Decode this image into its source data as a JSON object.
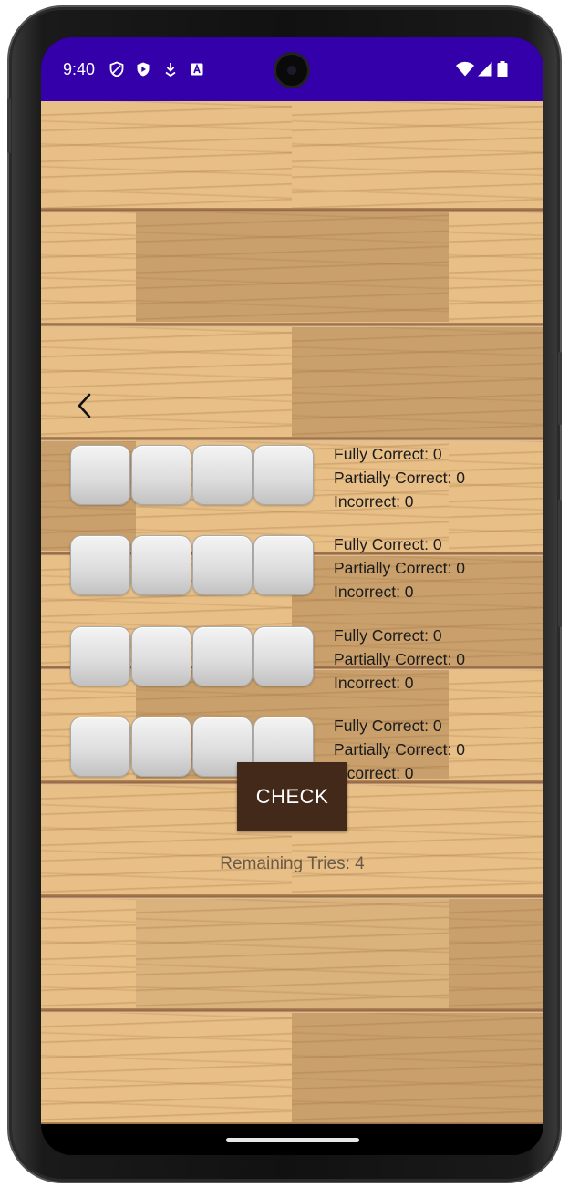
{
  "status_bar": {
    "time": "9:40",
    "left_icons": [
      "shield-outline-icon",
      "shield-play-icon",
      "download-arrow-icon",
      "a-box-icon"
    ],
    "right_icons": [
      "wifi-icon",
      "signal-icon",
      "battery-icon"
    ],
    "background_color": "#3300aa"
  },
  "board": {
    "rows": [
      {
        "fully_correct": "Fully Correct: 0",
        "partially_correct": "Partially Correct: 0",
        "incorrect": "Incorrect: 0"
      },
      {
        "fully_correct": "Fully Correct: 0",
        "partially_correct": "Partially Correct: 0",
        "incorrect": "Incorrect: 0"
      },
      {
        "fully_correct": "Fully Correct: 0",
        "partially_correct": "Partially Correct: 0",
        "incorrect": "Incorrect: 0"
      },
      {
        "fully_correct": "Fully Correct: 0",
        "partially_correct": "Partially Correct: 0",
        "incorrect": "Incorrect: 0"
      }
    ]
  },
  "actions": {
    "check_label": "CHECK",
    "check_color": "#43291a"
  },
  "footer": {
    "remaining_tries": "Remaining Tries: 4"
  },
  "navigation": {
    "back_icon": "chevron-left-icon"
  }
}
